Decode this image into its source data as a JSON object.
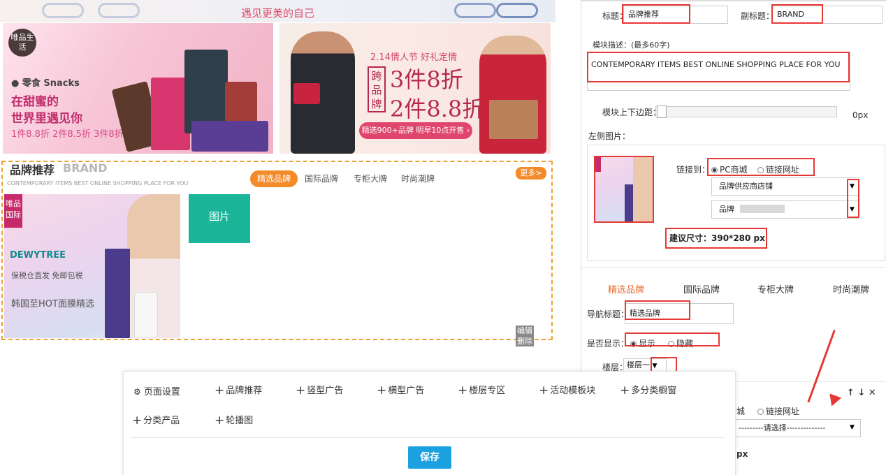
{
  "preview": {
    "banner_top_text": "遇见更美的自己",
    "promo_left": {
      "badge": "唯品生活",
      "label": "零食 Snacks",
      "line1": "在甜蜜的",
      "line2": "世界里遇见你",
      "line3": "1件8.8折 2件8.5折 3件8折"
    },
    "promo_right": {
      "title": "2.14情人节 好礼定情",
      "cross": "跨品牌",
      "offer1": "3件8折",
      "offer2": "2件8.8折",
      "strip": "精选900+品牌 明早10点开售 ›"
    },
    "brand": {
      "title": "品牌推荐",
      "subtitle": "BRAND",
      "desc": "CONTEMPORARY ITEMS BEST ONLINE SHOPPING PLACE FOR YOU",
      "tabs": [
        "精选品牌",
        "国际品牌",
        "专柜大牌",
        "时尚潮牌"
      ],
      "more": "更多>",
      "tag": "唯品国际",
      "dewy": "DEWYTREE",
      "dewy_line2": "保税仓直发 免邮包税",
      "dewy_line3": "韩国至HOT面膜精选",
      "pic_block": "图片",
      "edit": "编辑",
      "delete": "删除"
    }
  },
  "settings": {
    "title_label": "标题：",
    "title_value": "品牌推荐",
    "subtitle_label": "副标题：",
    "subtitle_value": "BRAND",
    "desc_label": "模块描述：(最多60字)",
    "desc_value": "CONTEMPORARY ITEMS BEST ONLINE SHOPPING PLACE FOR YOU",
    "margin_label": "模块上下边距：",
    "margin_value": "0px",
    "left_img_label": "左侧图片：",
    "link_label": "链接到：",
    "link_opt1": "PC商城",
    "link_opt2": "链接网址",
    "select1": "品牌供应商店铺",
    "select2": "品牌",
    "size_hint": "建议尺寸：390*280 px",
    "nav_tabs": [
      "精选品牌",
      "国际品牌",
      "专柜大牌",
      "时尚潮牌"
    ],
    "nav_title_label": "导航标题：",
    "nav_title_value": "精选品牌",
    "show_label": "是否显示：",
    "show_opt1": "显示",
    "show_opt2": "隐藏",
    "floor_label": "楼层：",
    "floor_value": "楼层一",
    "lower_link_opt1": "城",
    "lower_link_opt2": "链接网址",
    "lower_select": "---------请选择--------------",
    "lower_px": "px",
    "row_icons": [
      "arrow-up-icon",
      "arrow-down-icon",
      "close-icon"
    ]
  },
  "toolbar": {
    "page_settings": "页面设置",
    "items_row1": [
      "品牌推荐",
      "竖型广告",
      "横型广告",
      "楼层专区",
      "活动模板块",
      "多分类橱窗"
    ],
    "items_row2": [
      "分类产品",
      "轮播图"
    ],
    "save": "保存"
  },
  "colors": {
    "accent_orange": "#f38b2a",
    "highlight_red": "#e53935",
    "save_blue": "#1ba0e0",
    "pic_green": "#1bb59a"
  }
}
